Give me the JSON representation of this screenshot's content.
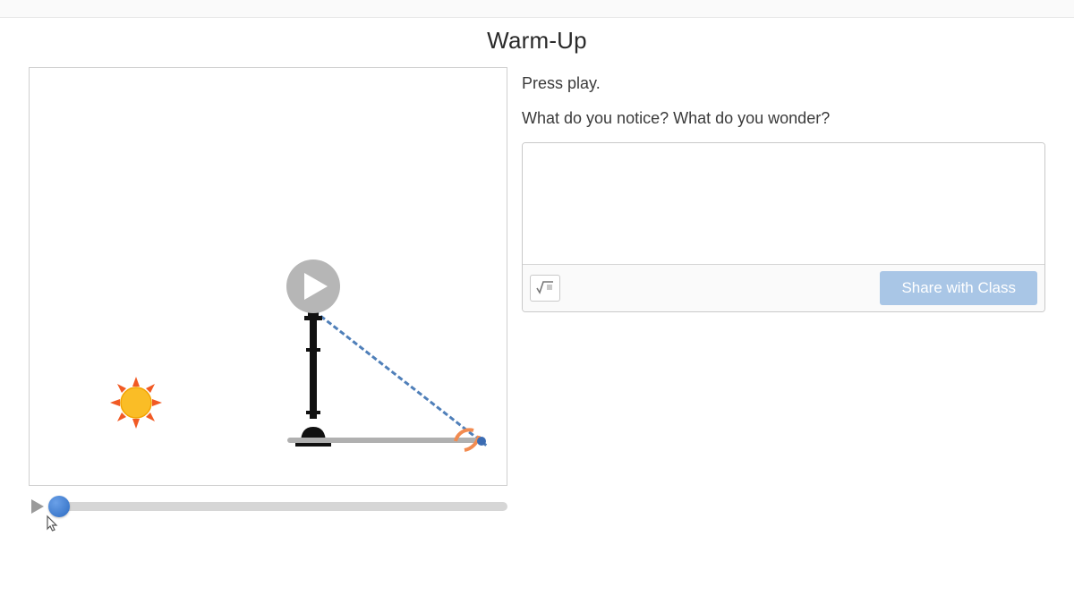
{
  "header": {
    "title": "Warm-Up"
  },
  "animation": {
    "slider": {
      "position_pct": 0
    }
  },
  "prompt": {
    "line1": "Press play.",
    "line2": "What do you notice?  What do you wonder?"
  },
  "response": {
    "textarea_value": "",
    "textarea_placeholder": "",
    "math_tool_label": "√",
    "share_label": "Share with Class"
  },
  "icons": {
    "play_overlay": "play-icon",
    "slider_play": "play-small-icon",
    "sun": "sun-icon",
    "lamppost": "lamppost-icon",
    "cursor": "cursor-pointer-icon",
    "math": "sqrt-icon"
  },
  "colors": {
    "accent_blue": "#3b6cb3",
    "share_btn_bg": "#a9c6e6",
    "sun_fill": "#fabd26",
    "sun_rays": "#f15a24"
  }
}
